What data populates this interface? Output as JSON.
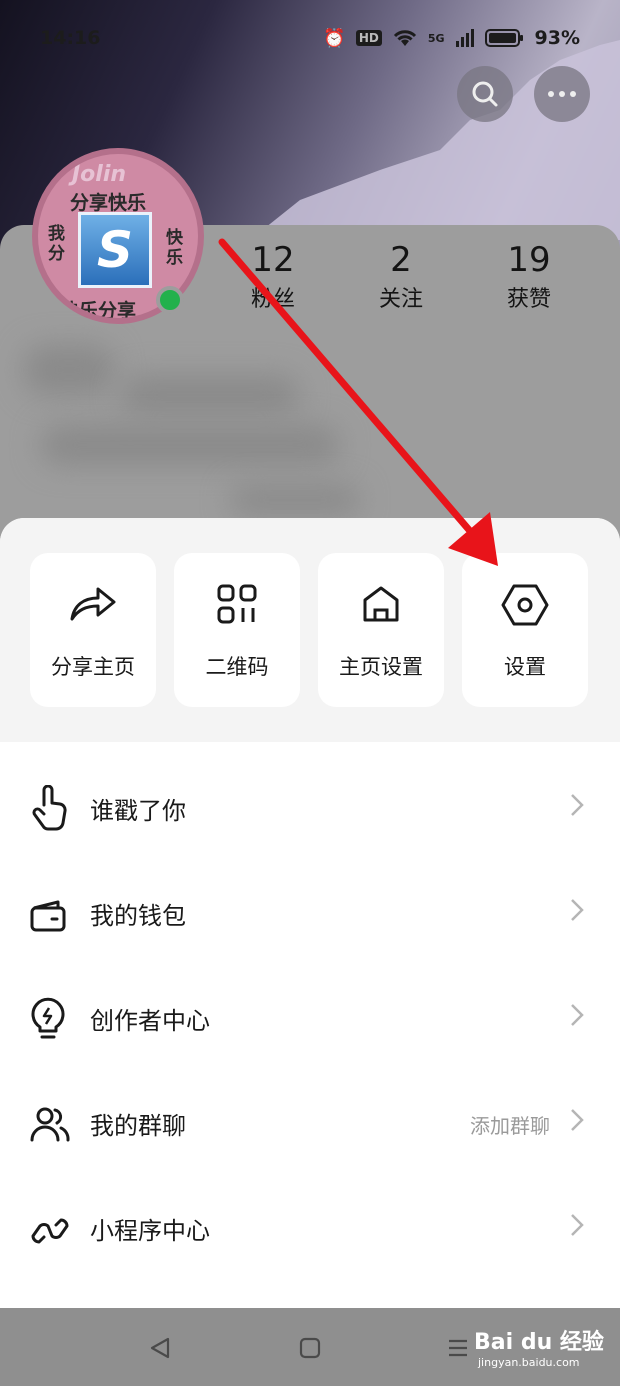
{
  "status_bar": {
    "time": "14:16",
    "hd": "HD",
    "network": "5G",
    "battery": "93%"
  },
  "avatar": {
    "brand": "Jolin",
    "line1": "分享快乐",
    "left_text": "我分",
    "right_text": "快乐",
    "bottom_text": "快乐分享",
    "logo_letter": "S"
  },
  "stats": [
    {
      "value": "12",
      "label": "粉丝"
    },
    {
      "value": "2",
      "label": "关注"
    },
    {
      "value": "19",
      "label": "获赞"
    }
  ],
  "quick_actions": [
    {
      "label": "分享主页",
      "icon": "share-icon"
    },
    {
      "label": "二维码",
      "icon": "qr-code-icon"
    },
    {
      "label": "主页设置",
      "icon": "home-icon"
    },
    {
      "label": "设置",
      "icon": "settings-hex-icon"
    }
  ],
  "menu": [
    {
      "label": "谁戳了你",
      "icon": "poke-hand-icon",
      "hint": ""
    },
    {
      "label": "我的钱包",
      "icon": "wallet-icon",
      "hint": ""
    },
    {
      "label": "创作者中心",
      "icon": "lightbulb-icon",
      "hint": ""
    },
    {
      "label": "我的群聊",
      "icon": "group-users-icon",
      "hint": "添加群聊"
    },
    {
      "label": "小程序中心",
      "icon": "mini-program-icon",
      "hint": ""
    }
  ],
  "watermark": {
    "brand": "Bai du 经验",
    "url": "jingyan.baidu.com"
  },
  "colors": {
    "annotation_arrow": "#e8141a",
    "online": "#22b14c",
    "sheet_bg": "#f4f4f4"
  }
}
